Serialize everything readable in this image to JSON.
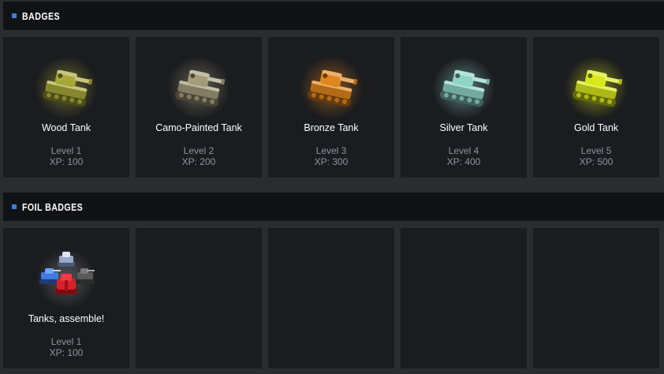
{
  "badges_section": {
    "title": "BADGES",
    "items": [
      {
        "name": "Wood Tank",
        "level": "Level 1",
        "xp": "XP: 100",
        "color": "#a8a83a",
        "icon": "tank-icon"
      },
      {
        "name": "Camo-Painted Tank",
        "level": "Level 2",
        "xp": "XP: 200",
        "color": "#a39b7a",
        "icon": "tank-icon"
      },
      {
        "name": "Bronze Tank",
        "level": "Level 3",
        "xp": "XP: 300",
        "color": "#e0861e",
        "icon": "tank-icon"
      },
      {
        "name": "Silver Tank",
        "level": "Level 4",
        "xp": "XP: 400",
        "color": "#8fd4c8",
        "icon": "tank-icon"
      },
      {
        "name": "Gold Tank",
        "level": "Level 5",
        "xp": "XP: 500",
        "color": "#d8e81a",
        "icon": "tank-icon"
      }
    ]
  },
  "foil_section": {
    "title": "FOIL BADGES",
    "items": [
      {
        "name": "Tanks, assemble!",
        "level": "Level 1",
        "xp": "XP: 100",
        "icon": "tank-group-icon"
      }
    ]
  },
  "colors": {
    "accent": "#3b7fd6",
    "card": "#1b1c1f",
    "header": "#111214",
    "background": "#2a2c30",
    "muted_text": "#8f939a"
  }
}
